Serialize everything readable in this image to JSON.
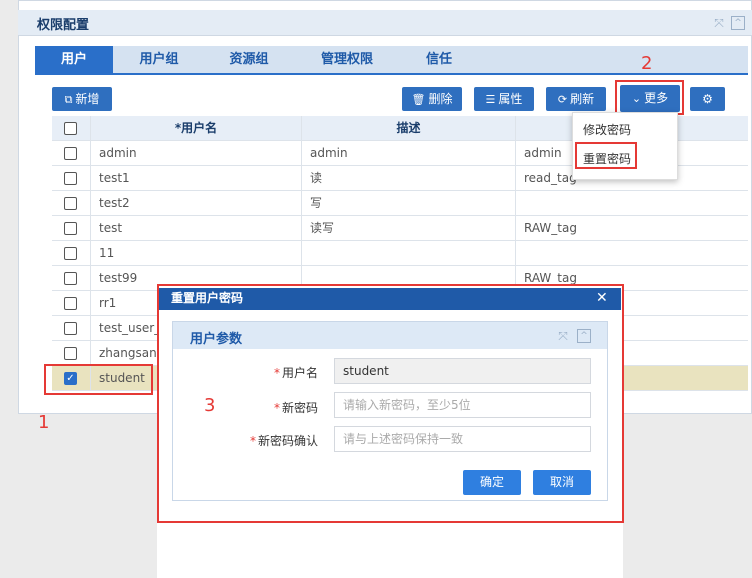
{
  "panel": {
    "title": "权限配置"
  },
  "tabs": [
    "用户",
    "用户组",
    "资源组",
    "管理权限",
    "信任"
  ],
  "toolbar": {
    "add": "新增",
    "delete": "删除",
    "properties": "属性",
    "refresh": "刷新",
    "more": "更多"
  },
  "more_menu": [
    "修改密码",
    "重置密码"
  ],
  "table": {
    "headers": [
      "*用户名",
      "描述",
      ""
    ],
    "rows": [
      {
        "name": "admin",
        "desc": "admin",
        "tag": "admin"
      },
      {
        "name": "test1",
        "desc": "读",
        "tag": "read_tag"
      },
      {
        "name": "test2",
        "desc": "写",
        "tag": ""
      },
      {
        "name": "test",
        "desc": "读写",
        "tag": "RAW_tag"
      },
      {
        "name": "11",
        "desc": "",
        "tag": ""
      },
      {
        "name": "test99",
        "desc": "",
        "tag": "RAW_tag"
      },
      {
        "name": "rr1",
        "desc": "",
        "tag": ""
      },
      {
        "name": "test_user_",
        "desc": "",
        "tag": ""
      },
      {
        "name": "zhangsan",
        "desc": "",
        "tag": ""
      },
      {
        "name": "student",
        "desc": "",
        "tag": ""
      }
    ],
    "selected_row": "student"
  },
  "dialog": {
    "title": "重置用户密码",
    "section_title": "用户参数",
    "fields": {
      "username": {
        "label": "用户名",
        "value": "student"
      },
      "new_password": {
        "label": "新密码",
        "placeholder": "请输入新密码，至少5位"
      },
      "confirm_password": {
        "label": "新密码确认",
        "placeholder": "请与上述密码保持一致"
      }
    },
    "confirm": "确定",
    "cancel": "取消"
  },
  "annotations": [
    "1",
    "2",
    "3"
  ],
  "colors": {
    "primary": "#2f6fbf",
    "header": "#1f5aa8",
    "annotation": "#e53935",
    "selected_row": "#e9e3bf"
  }
}
